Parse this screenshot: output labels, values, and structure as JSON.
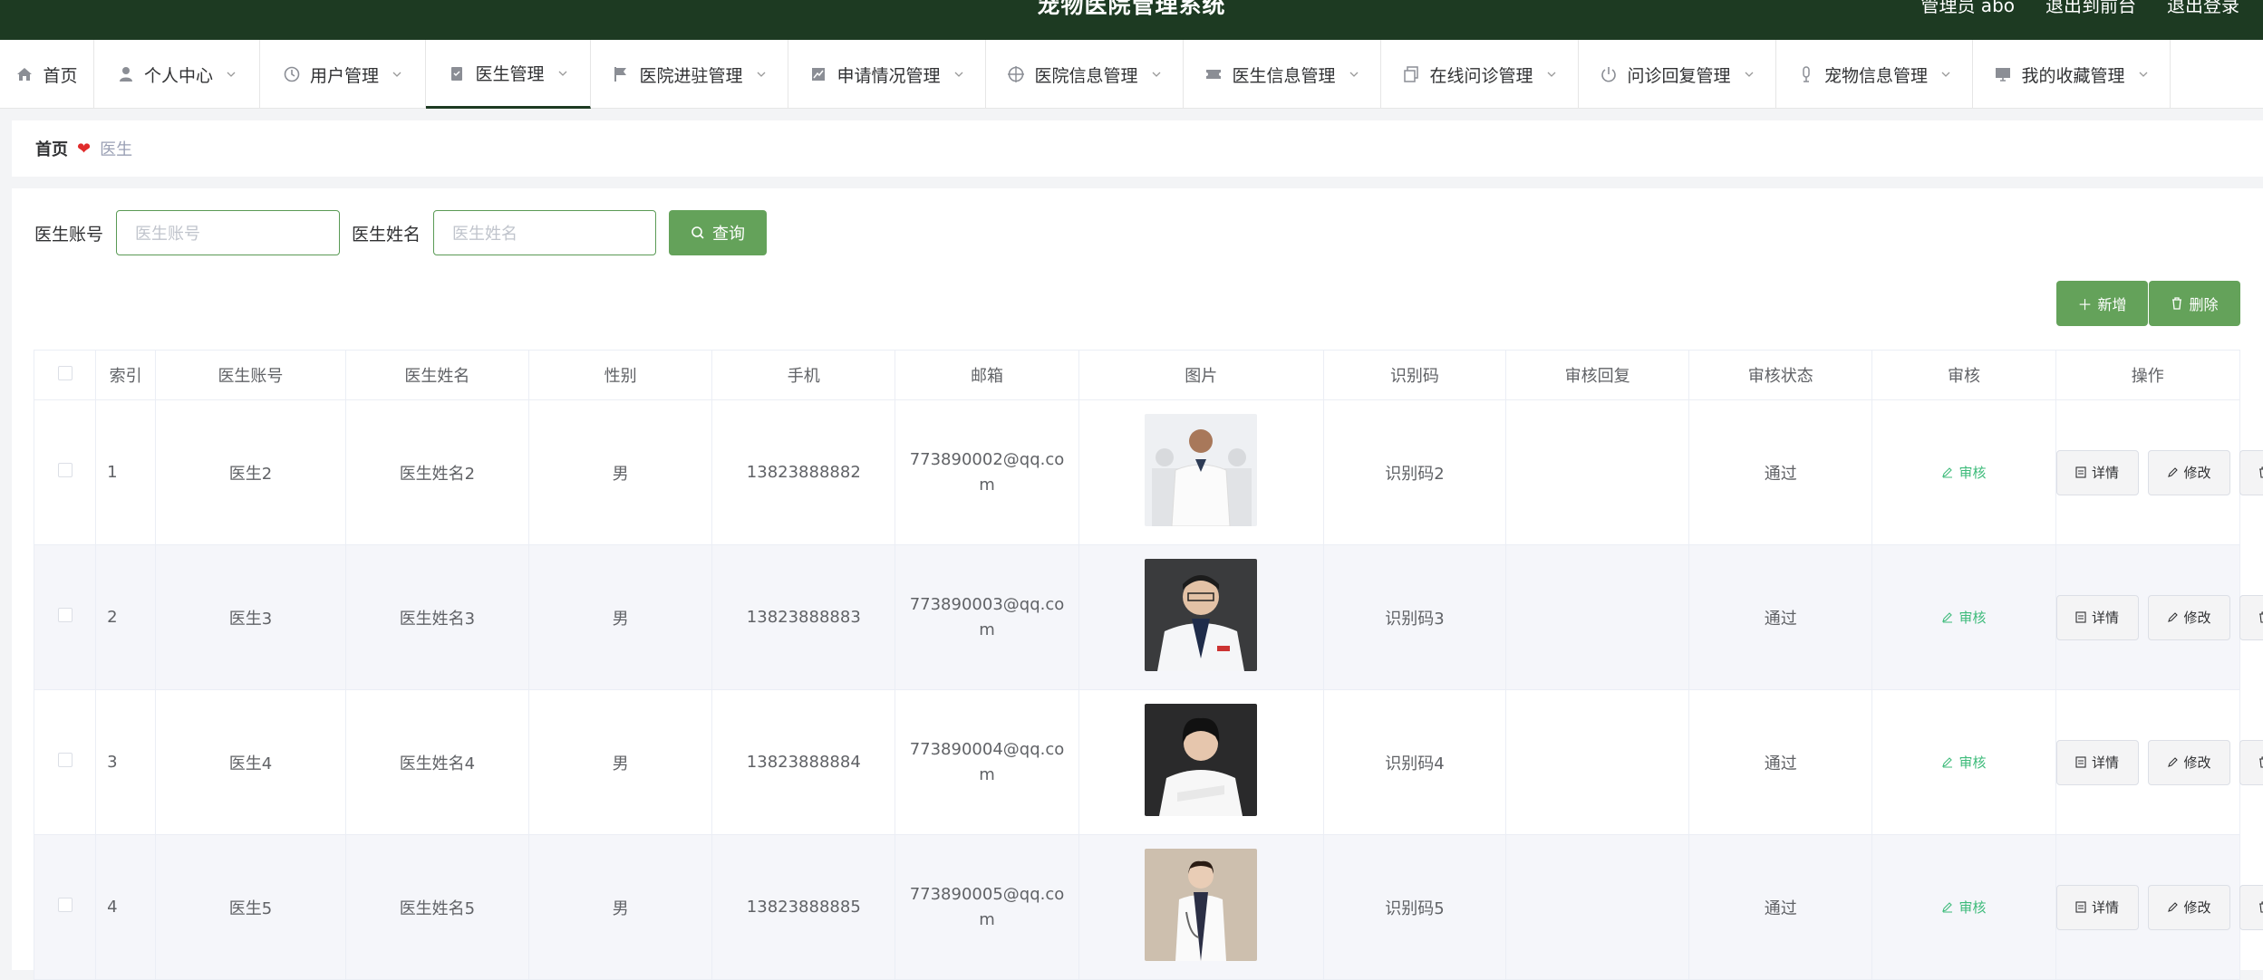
{
  "header": {
    "title": "宠物医院管理系统",
    "admin": "管理员 abo",
    "to_front": "退出到前台",
    "logout": "退出登录"
  },
  "nav": [
    {
      "label": "首页",
      "icon": "home-icon"
    },
    {
      "label": "个人中心",
      "icon": "user-icon"
    },
    {
      "label": "用户管理",
      "icon": "clock-icon"
    },
    {
      "label": "医生管理",
      "icon": "clipboard-icon"
    },
    {
      "label": "医院进驻管理",
      "icon": "flag-icon"
    },
    {
      "label": "申请情况管理",
      "icon": "chart-icon"
    },
    {
      "label": "医院信息管理",
      "icon": "target-icon"
    },
    {
      "label": "医生信息管理",
      "icon": "ticket-icon"
    },
    {
      "label": "在线问诊管理",
      "icon": "copy-icon"
    },
    {
      "label": "问诊回复管理",
      "icon": "power-icon"
    },
    {
      "label": "宠物信息管理",
      "icon": "mic-icon"
    },
    {
      "label": "我的收藏管理",
      "icon": "monitor-icon"
    }
  ],
  "breadcrumb": {
    "home": "首页",
    "current": "医生"
  },
  "search": {
    "account_label": "医生账号",
    "account_placeholder": "医生账号",
    "name_label": "医生姓名",
    "name_placeholder": "医生姓名",
    "query_label": "查询"
  },
  "toolbar": {
    "add_label": "新增",
    "delete_label": "删除"
  },
  "table": {
    "columns": [
      "索引",
      "医生账号",
      "医生姓名",
      "性别",
      "手机",
      "邮箱",
      "图片",
      "识别码",
      "审核回复",
      "审核状态",
      "审核",
      "操作"
    ],
    "audit_label": "审核",
    "detail_label": "详情",
    "edit_label": "修改",
    "delete_label": "删除",
    "rows": [
      {
        "index": "1",
        "account": "医生2",
        "name": "医生姓名2",
        "gender": "男",
        "phone": "13823888882",
        "email": "773890002@qq.com",
        "code": "识别码2",
        "reply": "",
        "status": "通过"
      },
      {
        "index": "2",
        "account": "医生3",
        "name": "医生姓名3",
        "gender": "男",
        "phone": "13823888883",
        "email": "773890003@qq.com",
        "code": "识别码3",
        "reply": "",
        "status": "通过"
      },
      {
        "index": "3",
        "account": "医生4",
        "name": "医生姓名4",
        "gender": "男",
        "phone": "13823888884",
        "email": "773890004@qq.com",
        "code": "识别码4",
        "reply": "",
        "status": "通过"
      },
      {
        "index": "4",
        "account": "医生5",
        "name": "医生姓名5",
        "gender": "男",
        "phone": "13823888885",
        "email": "773890005@qq.com",
        "code": "识别码5",
        "reply": "",
        "status": "通过"
      }
    ]
  },
  "colors": {
    "header_bg": "#1d3a22",
    "accent": "#64a25a",
    "audit_text": "#3dbb7a"
  }
}
